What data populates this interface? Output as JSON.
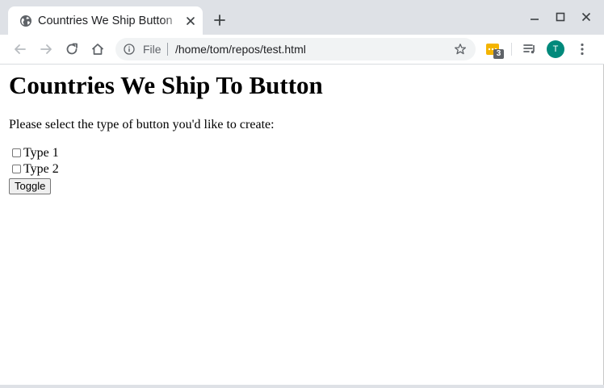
{
  "browser": {
    "tab": {
      "title": "Countries We Ship Button",
      "favicon": "globe-icon"
    },
    "address": {
      "scheme_label": "File",
      "url": "/home/tom/repos/test.html"
    },
    "extension_badge": "3",
    "profile_initial": "T",
    "colors": {
      "tabstrip": "#dee1e6",
      "avatar": "#00897b",
      "omnibox": "#f1f3f4"
    }
  },
  "page": {
    "heading": "Countries We Ship To Button",
    "prompt": "Please select the type of button you'd like to create:",
    "options": [
      {
        "label": "Type 1",
        "checked": false
      },
      {
        "label": "Type 2",
        "checked": false
      }
    ],
    "toggle_label": "Toggle"
  }
}
